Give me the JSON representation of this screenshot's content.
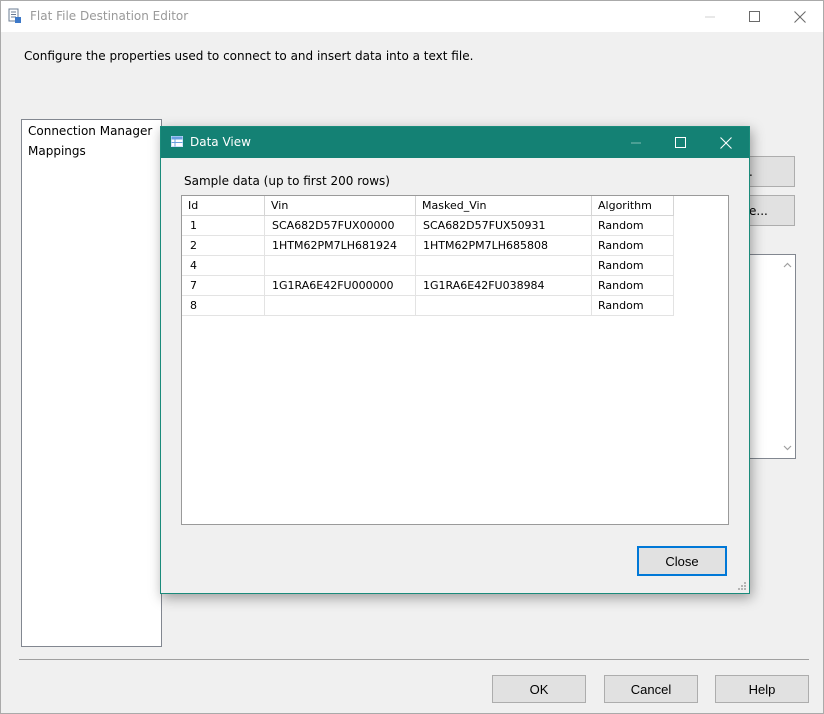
{
  "outer": {
    "title": "Flat File Destination Editor",
    "instruction": "Configure the properties used to connect to and insert data into a text file.",
    "nav": [
      {
        "label": "Connection Manager"
      },
      {
        "label": "Mappings"
      }
    ],
    "partial_buttons": [
      {
        "label": "."
      },
      {
        "label": "e..."
      }
    ],
    "buttons": {
      "ok": "OK",
      "cancel": "Cancel",
      "help": "Help"
    }
  },
  "dialog": {
    "title": "Data View",
    "sample_label": "Sample data (up to first 200 rows)",
    "columns": [
      "Id",
      "Vin",
      "Masked_Vin",
      "Algorithm"
    ],
    "rows": [
      [
        "1",
        "SCA682D57FUX00000",
        "SCA682D57FUX50931",
        "Random"
      ],
      [
        "2",
        "1HTM62PM7LH681924",
        "1HTM62PM7LH685808",
        "Random"
      ],
      [
        "4",
        "",
        "",
        "Random"
      ],
      [
        "7",
        "1G1RA6E42FU000000",
        "1G1RA6E42FU038984",
        "Random"
      ],
      [
        "8",
        "",
        "",
        "Random"
      ]
    ],
    "close_label": "Close"
  },
  "colors": {
    "accent": "#148174",
    "focus": "#0078d7"
  }
}
